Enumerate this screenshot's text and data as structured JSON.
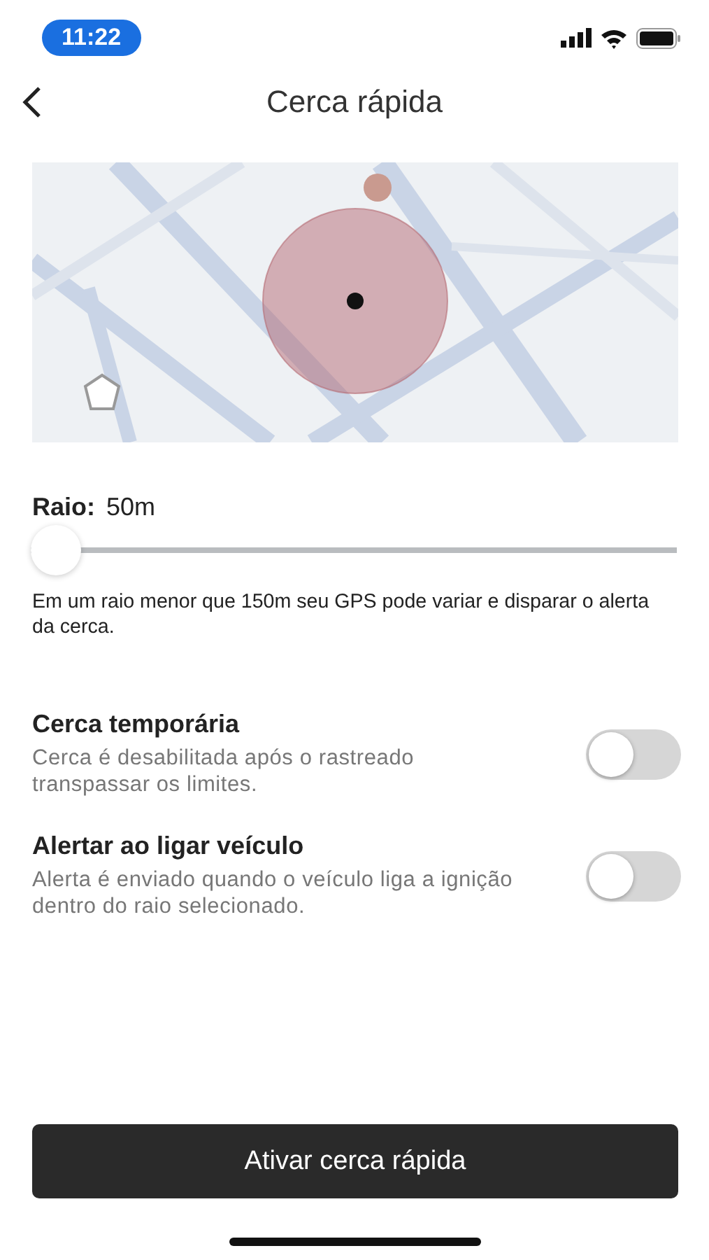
{
  "status_bar": {
    "time": "11:22"
  },
  "header": {
    "title": "Cerca rápida"
  },
  "radius": {
    "label": "Raio:",
    "value": "50m",
    "level": 0,
    "note": "Em um raio menor que 150m seu GPS pode variar e disparar o alerta da cerca."
  },
  "options": [
    {
      "title": "Cerca temporária",
      "description": "Cerca é desabilitada após o rastreado transpassar os limites.",
      "on": false
    },
    {
      "title": "Alertar ao ligar veículo",
      "description": "Alerta é enviado quando o veículo liga a ignição dentro do raio selecionado.",
      "on": false
    }
  ],
  "primary_button": {
    "label": "Ativar cerca rápida"
  }
}
